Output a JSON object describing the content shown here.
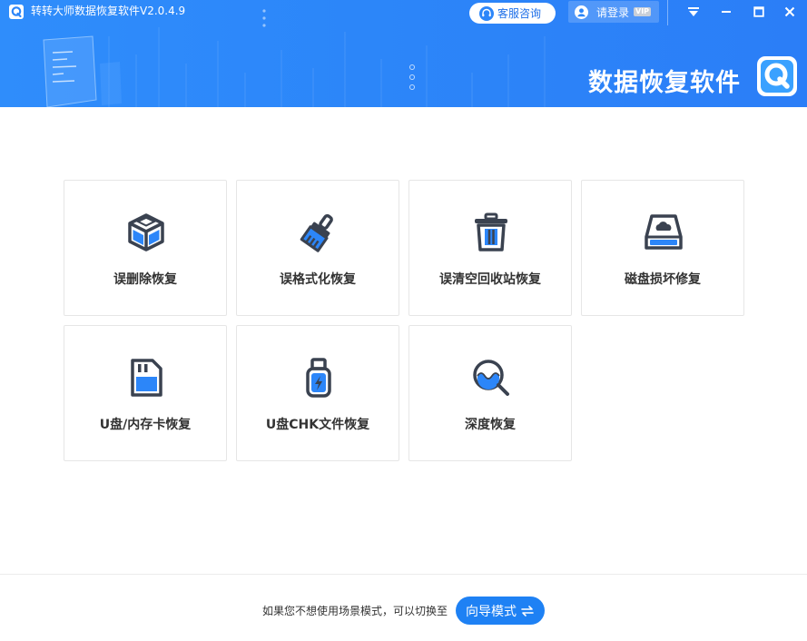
{
  "window": {
    "title": "转转大师数据恢复软件V2.0.4.9"
  },
  "header": {
    "service_label": "客服咨询",
    "login_label": "请登录",
    "vip_label": "VIP",
    "brand_text": "数据恢复软件"
  },
  "cards": [
    {
      "label": "误删除恢复",
      "icon": "box-icon"
    },
    {
      "label": "误格式化恢复",
      "icon": "brush-icon"
    },
    {
      "label": "误清空回收站恢复",
      "icon": "trash-icon"
    },
    {
      "label": "磁盘损坏修复",
      "icon": "disk-icon"
    },
    {
      "label": "U盘/内存卡恢复",
      "icon": "sd-card-icon"
    },
    {
      "label": "U盘CHK文件恢复",
      "icon": "usb-drive-icon"
    },
    {
      "label": "深度恢复",
      "icon": "deep-search-icon"
    }
  ],
  "footer": {
    "hint_text": "如果您不想使用场景模式，可以切换至",
    "guide_button_label": "向导模式"
  },
  "colors": {
    "header_blue": "#2c86f9",
    "accent_blue": "#1e81f4",
    "icon_dark": "#3a4250"
  }
}
